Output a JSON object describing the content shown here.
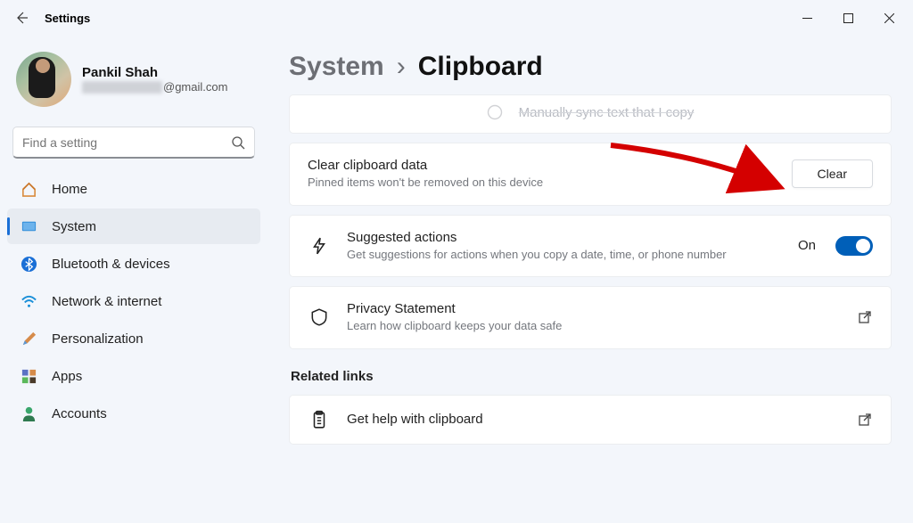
{
  "titlebar": {
    "app_title": "Settings"
  },
  "profile": {
    "name": "Pankil Shah",
    "email_domain": "@gmail.com"
  },
  "search": {
    "placeholder": "Find a setting"
  },
  "nav": {
    "home": "Home",
    "system": "System",
    "bluetooth": "Bluetooth & devices",
    "network": "Network & internet",
    "personalization": "Personalization",
    "apps": "Apps",
    "accounts": "Accounts"
  },
  "breadcrumb": {
    "parent": "System",
    "current": "Clipboard"
  },
  "cards": {
    "truncated_hint": "Manually sync text that I copy",
    "clear": {
      "title": "Clear clipboard data",
      "desc": "Pinned items won't be removed on this device",
      "button": "Clear"
    },
    "suggested": {
      "title": "Suggested actions",
      "desc": "Get suggestions for actions when you copy a date, time, or phone number",
      "state": "On"
    },
    "privacy": {
      "title": "Privacy Statement",
      "desc": "Learn how clipboard keeps your data safe"
    }
  },
  "related": {
    "heading": "Related links",
    "help": "Get help with clipboard"
  }
}
